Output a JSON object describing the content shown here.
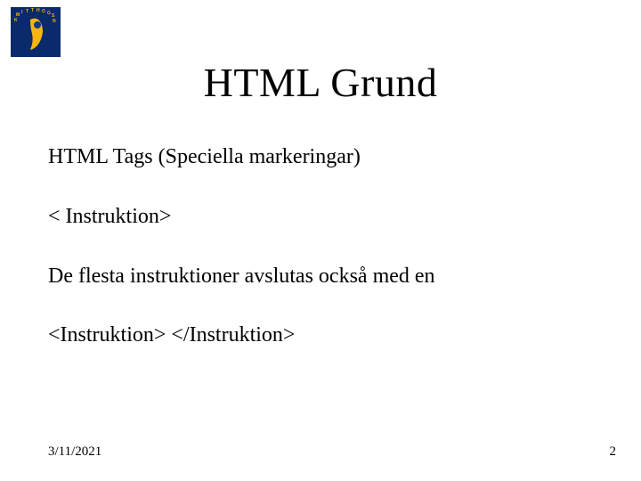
{
  "logo": {
    "name": "mitthogskolan-logo",
    "bg": "#0a2a6b",
    "shape_fill": "#f7b50f",
    "dot_fill": "#0f3a8a",
    "text_fill": "#f7b50f"
  },
  "title": "HTML Grund",
  "body": {
    "line1": "HTML Tags (Speciella markeringar)",
    "line2": "< Instruktion>",
    "line3": "De flesta instruktioner avslutas också med en",
    "line4": "<Instruktion> </Instruktion>"
  },
  "footer": {
    "date": "3/11/2021",
    "page": "2"
  }
}
